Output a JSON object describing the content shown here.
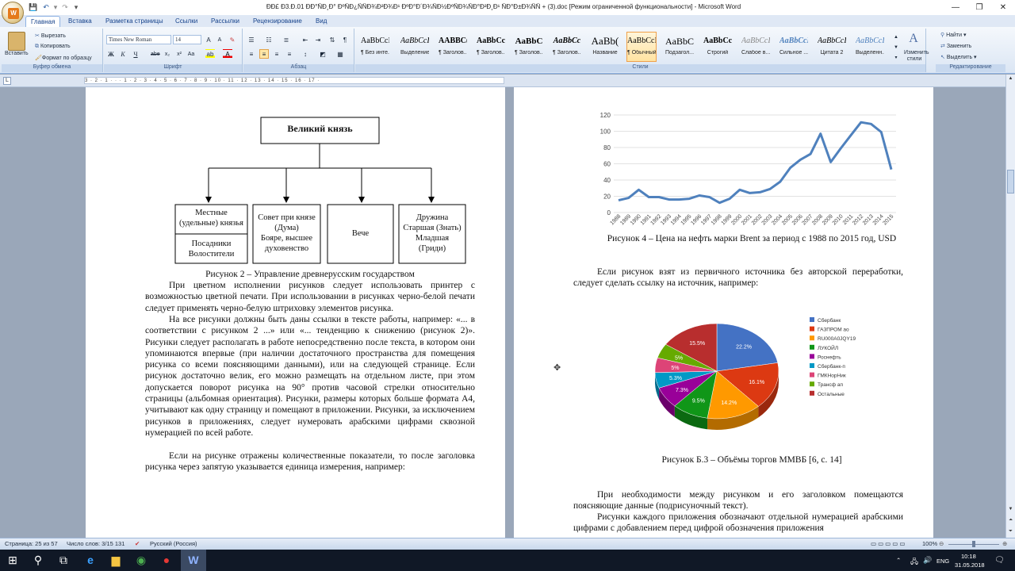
{
  "window": {
    "title": "ÐÐ£ Ð3.Ð.01 ÐÐ°ÑÐ¸Ð° ÐºÑÐ¿ÑÑÐ¾Ð²Ð¾Ð¹ ÐºÐ°Ð´Ð¾ÑÐ½ÐºÑÐ¾ÑÐ°Ð²Ð¸Ð¹ ÑÐ°Ð±Ð¾ÑÑ + (3).doc [Режим ограниченной функциональности] - Microsoft Word",
    "minimize_glyph": "—",
    "restore_glyph": "❐",
    "close_glyph": "✕"
  },
  "tabs": [
    "Главная",
    "Вставка",
    "Разметка страницы",
    "Ссылки",
    "Рассылки",
    "Рецензирование",
    "Вид"
  ],
  "ribbon": {
    "clipboard": {
      "paste": "Вставить",
      "cut": "Вырезать",
      "copy": "Копировать",
      "format_painter": "Формат по образцу",
      "label": "Буфер обмена"
    },
    "font": {
      "name": "Times New Roman",
      "size": "14",
      "label": "Шрифт",
      "bold": "Ж",
      "italic": "К",
      "underline": "Ч"
    },
    "paragraph": {
      "label": "Абзац"
    },
    "styles": {
      "label": "Стили",
      "items": [
        {
          "preview": "AaBbCcI",
          "name": "¶ Без инте..."
        },
        {
          "preview": "AaBbCcI",
          "name": "Выделение"
        },
        {
          "preview": "AABBC(",
          "name": "¶ Заголов..."
        },
        {
          "preview": "AaBbCcI",
          "name": "¶ Заголов..."
        },
        {
          "preview": "AaBbC",
          "name": "¶ Заголов..."
        },
        {
          "preview": "AaBbCc",
          "name": "¶ Заголов..."
        },
        {
          "preview": "AaBb(",
          "name": "Название"
        },
        {
          "preview": "AaBbCcI",
          "name": "¶ Обычный"
        },
        {
          "preview": "AaBbC",
          "name": "Подзагол..."
        },
        {
          "preview": "AaBbCcI",
          "name": "Строгий"
        },
        {
          "preview": "AaBbCcI",
          "name": "Слабое в..."
        },
        {
          "preview": "AaBbCcI",
          "name": "Сильное ..."
        },
        {
          "preview": "AaBbCcI",
          "name": "Цитата 2"
        },
        {
          "preview": "AaBbCcI",
          "name": "Выделенн..."
        }
      ],
      "change_styles": "Изменить стили"
    },
    "editing": {
      "find": "Найти",
      "replace": "Заменить",
      "select": "Выделить",
      "label": "Редактирование"
    }
  },
  "ruler": {
    "scale": "3 · 2 · 1 · · · 1 · 2 · 3 · 4 · 5 · 6 · 7 · 8 · 9 · 10 · 11 · 12 · 13 · 14 · 15 · 16 · 17 · "
  },
  "page1": {
    "org_top": "Великий князь",
    "org_boxes": [
      {
        "top": "Местные\n(удельные) князья",
        "bottom": "Посадники\nВолостители"
      },
      {
        "text": "Совет при князе\n(Дума)\nБояре, высшее\nдуховенство"
      },
      {
        "text": "Вече"
      },
      {
        "text": "Дружина\nСтаршая (Знать)\nМладшая\n(Гриди)"
      }
    ],
    "caption": "Рисунок 2 – Управление древнерусским государством",
    "para1": "При цветном исполнении рисунков следует использовать принтер с возможностью цветной печати. При использовании в рисунках черно-белой печати следует применять черно-белую штриховку элементов рисунка.",
    "para2": "На все рисунки должны быть даны ссылки в тексте работы, например: «... в соответствии с рисунком 2 ...» или «... тенденцию к снижению (рисунок 2)». Рисунки следует располагать в работе непосредственно после текста, в котором они упоминаются впервые (при наличии достаточного пространства для помещения рисунка со всеми поясняющими данными), или на следующей странице. Если рисунок достаточно велик, его можно размещать на отдельном листе, при этом допускается поворот рисунка на 90° против часовой стрелки относительно страницы (альбомная ориентация). Рисунки, размеры которых больше формата А4, учитывают как одну страницу и помещают в приложении. Рисунки, за исключением рисунков в приложениях, следует нумеровать арабскими цифрами сквозной нумерацией по всей работе.",
    "para3": "Если на рисунке отражены количественные показатели, то после заголовка рисунка через запятую указывается единица измерения, например:"
  },
  "page2": {
    "caption4": "Рисунок 4 – Цена на нефть марки Brent за период с 1988 по 2015 год, USD",
    "para_source": "Если рисунок взят из первичного источника без авторской переработки, следует сделать ссылку на источник, например:",
    "caption_b3": "Рисунок Б.3 – Объёмы торгов ММВБ [6, с. 14]",
    "para_note": "При необходимости между рисунком и его заголовком помещаются поясняющие данные (подрисуночный текст).",
    "para_app": "Рисунки каждого приложения обозначают отдельной нумерацией арабскими цифрами с добавлением перед цифрой обозначения приложения"
  },
  "chart_data": [
    {
      "type": "line",
      "x": [
        "1988",
        "1989",
        "1990",
        "1991",
        "1992",
        "1993",
        "1994",
        "1995",
        "1996",
        "1997",
        "1998",
        "1999",
        "2000",
        "2001",
        "2002",
        "2003",
        "2004",
        "2005",
        "2006",
        "2007",
        "2008",
        "2009",
        "2010",
        "2011",
        "2012",
        "2013",
        "2014",
        "2015"
      ],
      "values": [
        15,
        18,
        28,
        19,
        19,
        16,
        16,
        17,
        21,
        19,
        12,
        17,
        28,
        24,
        25,
        29,
        38,
        55,
        65,
        72,
        97,
        62,
        79,
        95,
        111,
        109,
        99,
        53
      ],
      "ylim": [
        0,
        120
      ],
      "yticks": [
        "0",
        "20",
        "40",
        "60",
        "80",
        "100",
        "120"
      ],
      "color": "#4f81bd",
      "grid": true
    },
    {
      "type": "pie",
      "labels": [
        "Сбербанк",
        "ГАЗПРОМ ао",
        "RU000A0JQY19",
        "ЛУКОЙЛ",
        "Роснефть",
        "Сбербанк-п",
        "ГМКНорНик",
        "Трансф ап",
        "Остальные"
      ],
      "values": [
        22.2,
        16.1,
        14.2,
        9.5,
        7.3,
        5.3,
        5,
        5,
        15.5
      ],
      "value_labels": [
        "22.2%",
        "16.1%",
        "14.2%",
        "9.5%",
        "7.3%",
        "5.3%",
        "5%",
        "5%",
        "15.5%"
      ],
      "colors": [
        "#4472c4",
        "#dc3912",
        "#ff9900",
        "#109618",
        "#990099",
        "#0099c6",
        "#dd4477",
        "#66aa00",
        "#b82e2e"
      ],
      "legend": "right"
    }
  ],
  "status": {
    "page": "Страница: 25 из 57",
    "words": "Число слов: 3/15 131",
    "language": "Русский (Россия)",
    "zoom": "100%"
  },
  "taskbar": {
    "lang": "ENG",
    "time": "10:18",
    "date": "31.05.2018"
  }
}
